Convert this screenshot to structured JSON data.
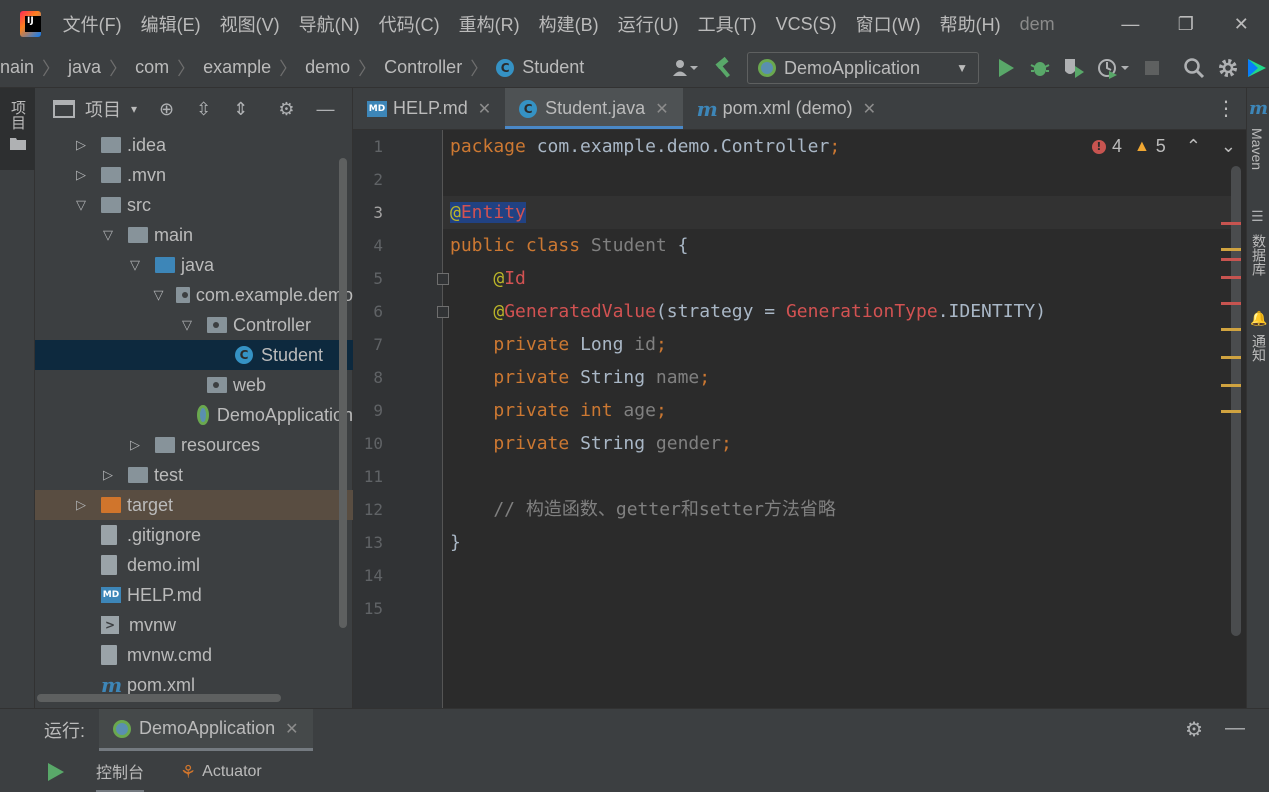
{
  "menu": {
    "items": [
      "文件(F)",
      "编辑(E)",
      "视图(V)",
      "导航(N)",
      "代码(C)",
      "重构(R)",
      "构建(B)",
      "运行(U)",
      "工具(T)",
      "VCS(S)",
      "窗口(W)",
      "帮助(H)"
    ],
    "window_title": "dem",
    "minimize": "—",
    "maximize": "❐",
    "close": "✕"
  },
  "breadcrumb": {
    "items": [
      "nain",
      "java",
      "com",
      "example",
      "demo",
      "Controller",
      "Student"
    ]
  },
  "toolbar": {
    "run_config": "DemoApplication"
  },
  "left_strip": {
    "project_label": "项目"
  },
  "project_panel": {
    "title": "项目",
    "tree": [
      {
        "label": ".idea",
        "depth": 1,
        "expand": "collapsed",
        "icon": "folder-icon"
      },
      {
        "label": ".mvn",
        "depth": 1,
        "expand": "collapsed",
        "icon": "folder-icon"
      },
      {
        "label": "src",
        "depth": 1,
        "expand": "expanded",
        "icon": "folder-icon"
      },
      {
        "label": "main",
        "depth": 2,
        "expand": "expanded",
        "icon": "folder-icon"
      },
      {
        "label": "java",
        "depth": 3,
        "expand": "expanded",
        "icon": "source-folder-icon"
      },
      {
        "label": "com.example.demo",
        "depth": 4,
        "expand": "expanded",
        "icon": "package-icon"
      },
      {
        "label": "Controller",
        "depth": 5,
        "expand": "expanded",
        "icon": "package-icon"
      },
      {
        "label": "Student",
        "depth": 6,
        "expand": "none",
        "icon": "class-icon",
        "selected": true
      },
      {
        "label": "web",
        "depth": 5,
        "expand": "none",
        "icon": "package-icon"
      },
      {
        "label": "DemoApplication",
        "depth": 5,
        "expand": "none",
        "icon": "spring-boot-icon"
      },
      {
        "label": "resources",
        "depth": 3,
        "expand": "collapsed",
        "icon": "resources-folder-icon"
      },
      {
        "label": "test",
        "depth": 2,
        "expand": "collapsed",
        "icon": "folder-icon"
      },
      {
        "label": "target",
        "depth": 1,
        "expand": "collapsed",
        "icon": "excluded-folder-icon",
        "excluded": true
      },
      {
        "label": ".gitignore",
        "depth": 1,
        "expand": "none",
        "icon": "file-icon"
      },
      {
        "label": "demo.iml",
        "depth": 1,
        "expand": "none",
        "icon": "file-icon"
      },
      {
        "label": "HELP.md",
        "depth": 1,
        "expand": "none",
        "icon": "markdown-icon"
      },
      {
        "label": "mvnw",
        "depth": 1,
        "expand": "none",
        "icon": "terminal-icon"
      },
      {
        "label": "mvnw.cmd",
        "depth": 1,
        "expand": "none",
        "icon": "file-icon"
      },
      {
        "label": "pom.xml",
        "depth": 1,
        "expand": "none",
        "icon": "maven-icon"
      }
    ]
  },
  "editor_tabs": [
    {
      "label": "HELP.md",
      "icon": "markdown-icon",
      "active": false
    },
    {
      "label": "Student.java",
      "icon": "class-icon",
      "active": true
    },
    {
      "label": "pom.xml (demo)",
      "icon": "maven-icon",
      "active": false
    }
  ],
  "editor": {
    "current_line": 3,
    "errors": "4",
    "warnings": "5",
    "lines": [
      [
        {
          "t": "package ",
          "c": "kw"
        },
        {
          "t": "com.example.demo.Controller",
          "c": "plain"
        },
        {
          "t": ";",
          "c": "kw"
        }
      ],
      [],
      [
        {
          "t": "@",
          "c": "sel-ann"
        },
        {
          "t": "Entity",
          "c": "sel-red"
        }
      ],
      [
        {
          "t": "public class ",
          "c": "kw"
        },
        {
          "t": "Student",
          "c": "gray"
        },
        {
          "t": " {",
          "c": "plain"
        }
      ],
      [
        {
          "t": "    ",
          "c": "plain"
        },
        {
          "t": "@",
          "c": "ann"
        },
        {
          "t": "Id",
          "c": "red"
        }
      ],
      [
        {
          "t": "    ",
          "c": "plain"
        },
        {
          "t": "@",
          "c": "ann"
        },
        {
          "t": "GeneratedValue",
          "c": "red"
        },
        {
          "t": "(strategy = ",
          "c": "plain"
        },
        {
          "t": "GenerationType",
          "c": "red"
        },
        {
          "t": ".IDENTITY)",
          "c": "plain"
        }
      ],
      [
        {
          "t": "    ",
          "c": "plain"
        },
        {
          "t": "private ",
          "c": "kw"
        },
        {
          "t": "Long ",
          "c": "plain"
        },
        {
          "t": "id",
          "c": "gray"
        },
        {
          "t": ";",
          "c": "kw"
        }
      ],
      [
        {
          "t": "    ",
          "c": "plain"
        },
        {
          "t": "private ",
          "c": "kw"
        },
        {
          "t": "String ",
          "c": "plain"
        },
        {
          "t": "name",
          "c": "gray"
        },
        {
          "t": ";",
          "c": "kw"
        }
      ],
      [
        {
          "t": "    ",
          "c": "plain"
        },
        {
          "t": "private ",
          "c": "kw"
        },
        {
          "t": "int ",
          "c": "kw"
        },
        {
          "t": "age",
          "c": "gray"
        },
        {
          "t": ";",
          "c": "kw"
        }
      ],
      [
        {
          "t": "    ",
          "c": "plain"
        },
        {
          "t": "private ",
          "c": "kw"
        },
        {
          "t": "String ",
          "c": "plain"
        },
        {
          "t": "gender",
          "c": "gray"
        },
        {
          "t": ";",
          "c": "kw"
        }
      ],
      [],
      [
        {
          "t": "    // 构造函数、getter和setter方法省略",
          "c": "comment"
        }
      ],
      [
        {
          "t": "}",
          "c": "plain"
        }
      ],
      [],
      []
    ]
  },
  "right_strip": {
    "maven": "Maven",
    "database": "数据库",
    "notifications": "通知"
  },
  "run_panel": {
    "label": "运行:",
    "tab": "DemoApplication",
    "sub_tabs": [
      "控制台",
      "Actuator"
    ]
  },
  "colors": {
    "accent": "#4a88c7",
    "error": "#c75450",
    "warning": "#f0a732",
    "selection": "#0d293e"
  }
}
